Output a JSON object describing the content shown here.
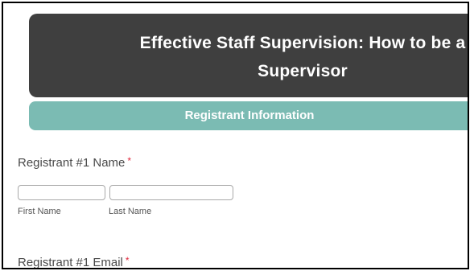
{
  "header": {
    "title_line1": "Effective Staff Supervision: How to be a",
    "title_line2": "Supervisor"
  },
  "section": {
    "title": "Registrant Information"
  },
  "form": {
    "name_field": {
      "label": "Registrant #1 Name",
      "required_mark": "*",
      "first_name_label": "First Name",
      "last_name_label": "Last Name",
      "first_name_value": "",
      "last_name_value": ""
    },
    "email_field": {
      "label": "Registrant #1 Email",
      "required_mark": "*"
    }
  },
  "colors": {
    "title_banner": "#3f3f3f",
    "section_banner": "#7bbbb3",
    "required": "#e0283c"
  }
}
